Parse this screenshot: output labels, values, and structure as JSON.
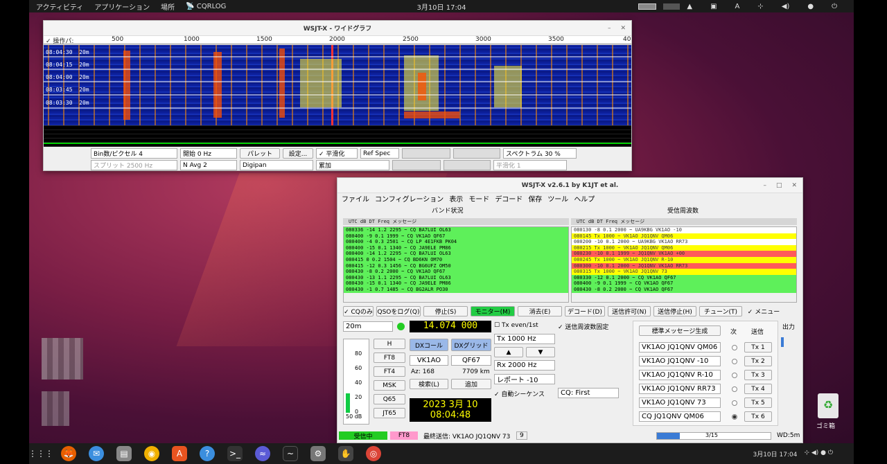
{
  "topbar": {
    "activities": "アクティビティ",
    "applications": "アプリケーション",
    "places": "場所",
    "app": "CQRLOG",
    "clock": "3月10日 17:04"
  },
  "waterfall": {
    "title": "WSJT-X - ワイドグラフ",
    "op_panel": "✓ 操作パ:",
    "scale": [
      "500",
      "1000",
      "1500",
      "2000",
      "2500",
      "3000",
      "3500",
      "40"
    ],
    "times": [
      "08:04:30",
      "08:04:15",
      "08:04:00",
      "08:03:45",
      "08:03:30"
    ],
    "band_tag": "20m",
    "row1": {
      "bin": "Bin数/ピクセル  4",
      "start": "開始 0 Hz",
      "palette": "パレット",
      "settings": "設定...",
      "smooth": "✓ 平滑化",
      "refspec": "Ref Spec",
      "spectrum": "スペクトラム 30 %"
    },
    "row2": {
      "split": "スプリット  2500  Hz",
      "navg": "N Avg 2",
      "pal_val": "Digipan",
      "mode": "累加",
      "smooth_val": "平滑化  1"
    }
  },
  "main": {
    "title": "WSJT-X   v2.6.1   by K1JT et al.",
    "menu": [
      "ファイル",
      "コンフィグレーション",
      "表示",
      "モード",
      "デコード",
      "保存",
      "ツール",
      "ヘルプ"
    ],
    "band_title": "バンド状況",
    "rx_title": "受信周波数",
    "hdr": "UTC   dB   DT Freq    メッセージ",
    "band_rows": [
      "080336 -14  1.2 2295 ~  CQ BA7LUI OL63",
      "080400  -9  0.1 1999 ~  CQ VK1AO QF67",
      "080400  -4  0.3 2501 ~  CQ LP 4E1FKB PK04",
      "080400 -15  0.1 1340 ~  CQ JA9ELE PM86",
      "080400 -14  1.2 2295 ~  CQ BA7LUI OL63",
      "080415   0  0.2 1504 ~  CQ BD6KN OM70",
      "080415 -12  0.3 1456 ~  CQ BG6UFZ OM50",
      "080430  -8  0.2 2000 ~  CQ VK1AO QF67",
      "080430 -13  1.1 2295 ~  CQ BA7LUI OL63",
      "080430 -15  0.1 1340 ~  CQ JA9ELE PM86",
      "080430  -1  0.7 1485 ~  CQ BG2ALR PO30"
    ],
    "rx_rows": [
      {
        "t": "080130  -8  0.1 2000 ~  UA9KBG VK1AO -10",
        "c": "w"
      },
      {
        "t": "080145  Tx        1000 ~  VK1AO JQ1QNV QM06",
        "c": "y"
      },
      {
        "t": "080200 -10  0.1 2000 ~  UA9KBG VK1AO RR73",
        "c": "w"
      },
      {
        "t": "080215  Tx        1000 ~  VK1AO JQ1QNV QM06",
        "c": "y"
      },
      {
        "t": "080230 -10  0.1 1999 ~  JQ1QNV VK1AO +00",
        "c": "r"
      },
      {
        "t": "080245  Tx        1000 ~  VK1AO JQ1QNV R-10",
        "c": "y"
      },
      {
        "t": "080300 -10  0.1 2000 ~  JQ1QNV VK1AO RR73",
        "c": "r"
      },
      {
        "t": "080315  Tx        1000 ~  VK1AO JQ1QNV 73",
        "c": "y"
      },
      {
        "t": "080330 -12  0.1 2000 ~  CQ VK1AO QF67",
        "c": "g"
      },
      {
        "t": "080400  -9  0.1 1999 ~  CQ VK1AO QF67",
        "c": "g"
      },
      {
        "t": "080430  -8  0.2 2000 ~  CQ VK1AO QF67",
        "c": "g"
      }
    ],
    "buttons": {
      "cq_only": "✓ CQのみ",
      "log_qso": "QSOをログ(Q)",
      "stop": "停止(S)",
      "monitor": "モニター(M)",
      "erase": "消去(E)",
      "decode": "デコード(D)",
      "enable_tx": "送信許可(N)",
      "halt_tx": "送信停止(H)",
      "tune": "チューン(T)",
      "menus": "✓ メニュー"
    },
    "band": "20m",
    "freq": "14.074 000",
    "tx_even": "Tx even/1st",
    "hold_tx": "✓ 送信周波数固定",
    "modes": [
      "H",
      "FT8",
      "FT4",
      "MSK",
      "Q65",
      "JT65"
    ],
    "meter": {
      "labels": [
        "80",
        "60",
        "40",
        "20",
        "0"
      ],
      "db": "50 dB",
      "level": 0.28
    },
    "dx_call_btn": "DXコール",
    "dx_grid_btn": "DXグリッド",
    "dx_call": "VK1AO",
    "dx_grid": "QF67",
    "az": "Az: 168",
    "dist": "7709 km",
    "lookup": "検索(L)",
    "add": "追加",
    "date": "2023 3月 10",
    "time": "08:04:48",
    "tx": "Tx  1000  Hz",
    "rx": "Rx  2000  Hz",
    "report": "レポート -10",
    "auto_seq": "✓ 自動シーケンス",
    "cq_first": "CQ: First",
    "gen_msgs": "標準メッセージ生成",
    "next": "次",
    "send": "送信",
    "messages": [
      "VK1AO JQ1QNV QM06",
      "VK1AO JQ1QNV -10",
      "VK1AO JQ1QNV R-10",
      "VK1AO JQ1QNV RR73",
      "VK1AO JQ1QNV 73",
      "CQ JQ1QNV QM06"
    ],
    "tx_labels": [
      "Tx 1",
      "Tx 2",
      "Tx 3",
      "Tx 4",
      "Tx 5",
      "Tx 6"
    ],
    "selected_tx": 6,
    "output": "出力",
    "status": {
      "rx": "受信中",
      "mode": "FT8",
      "last_tx": "最終送信: VK1AO JQ1QNV 73",
      "n": "9",
      "progress": "3/15",
      "progress_frac": 0.2,
      "wd": "WD:5m"
    }
  },
  "trash": "ゴミ箱",
  "colors": {
    "green": "#5ef05a",
    "yellow": "#ffff00",
    "red": "#ff5a5a",
    "monitor": "#22cc44"
  }
}
